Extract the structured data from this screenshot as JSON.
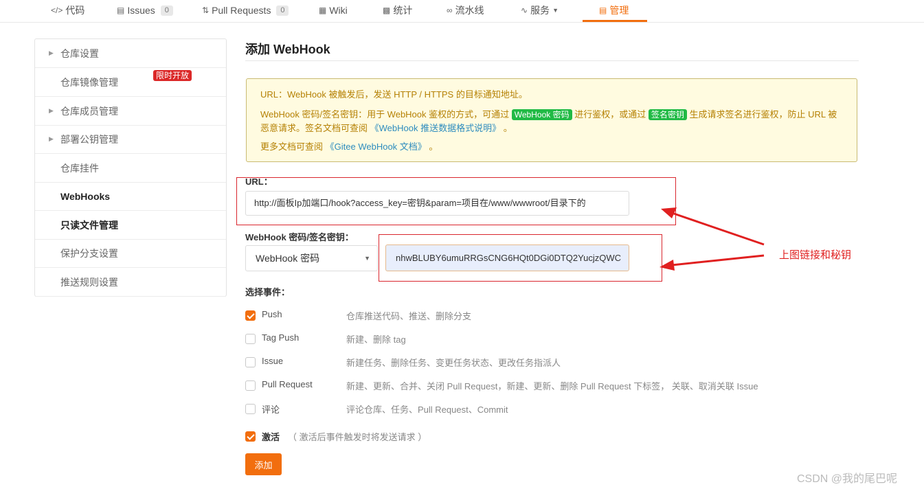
{
  "topnav": {
    "tabs": [
      {
        "label": "代码",
        "icon": "code-icon"
      },
      {
        "label": "Issues",
        "icon": "issues-icon",
        "count": "0"
      },
      {
        "label": "Pull Requests",
        "icon": "pull-request-icon",
        "count": "0"
      },
      {
        "label": "Wiki",
        "icon": "wiki-icon"
      },
      {
        "label": "统计",
        "icon": "stats-icon"
      },
      {
        "label": "流水线",
        "icon": "pipeline-icon"
      },
      {
        "label": "服务",
        "icon": "service-icon"
      },
      {
        "label": "管理",
        "icon": "manage-icon",
        "active": true
      }
    ],
    "accent_color": "#f26e0e"
  },
  "sidebar": {
    "items": [
      {
        "label": "仓库设置"
      },
      {
        "label": "仓库镜像管理",
        "badge": "限时开放"
      },
      {
        "label": "仓库成员管理"
      },
      {
        "label": "部署公钥管理"
      },
      {
        "label": "仓库挂件"
      },
      {
        "label": "WebHooks"
      },
      {
        "label": "只读文件管理"
      },
      {
        "label": "保护分支设置"
      },
      {
        "label": "推送规则设置"
      }
    ]
  },
  "main": {
    "title": "添加 WebHook",
    "notice": {
      "line1": "URL：WebHook 被触发后，发送 HTTP / HTTPS 的目标通知地址。",
      "line2_a": "WebHook 密码/签名密钥：用于 WebHook 鉴权的方式，可通过",
      "chip1": "WebHook 密码",
      "line2_b": "进行鉴权，或通过",
      "chip2": "签名密钥",
      "line2_c": "生成请求签名进行鉴权，防止 URL 被恶意请求。签名文档可查阅",
      "doc_link": "《WebHook 推送数据格式说明》",
      "line2_end": "。",
      "line3_a": "更多文档可查阅",
      "gitee_link": "《Gitee WebHook 文档》",
      "line3_end": "。"
    },
    "url_label": "URL：",
    "url_value": "http://面板Ip加端口/hook?access_key=密钥&param=项目在/www/wwwroot/目录下的",
    "secret_label": "WebHook 密码/签名密钥：",
    "secret_type": "WebHook 密码",
    "secret_value": "nhwBLUBY6umuRRGsCNG6HQt0DGi0DTQ2YucjzQWC",
    "events_label": "选择事件：",
    "events": [
      {
        "name": "Push",
        "desc": "仓库推送代码、推送、删除分支",
        "checked": true
      },
      {
        "name": "Tag Push",
        "desc": "新建、删除 tag",
        "checked": false
      },
      {
        "name": "Issue",
        "desc": "新建任务、删除任务、变更任务状态、更改任务指派人",
        "checked": false
      },
      {
        "name": "Pull Request",
        "desc": "新建、更新、合并、关闭 Pull Request，新建、更新、删除 Pull Request 下标签， 关联、取消关联 Issue",
        "checked": false
      },
      {
        "name": "评论",
        "desc": "评论仓库、任务、Pull Request、Commit",
        "checked": false
      }
    ],
    "active_label": "激活",
    "active_hint": "（ 激活后事件触发时将发送请求 ）",
    "active_checked": true,
    "submit_label": "添加"
  },
  "annotation": {
    "text": "上图链接和秘钥",
    "color": "#e02020"
  },
  "watermark": "CSDN @我的尾巴呢"
}
